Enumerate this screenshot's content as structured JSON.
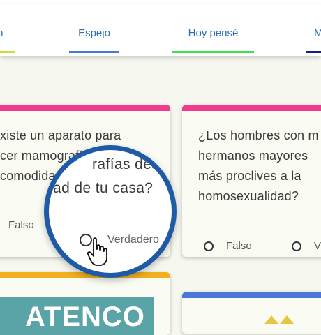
{
  "nav": {
    "items": [
      {
        "label": "o",
        "color": "#c6e234"
      },
      {
        "label": "Espejo",
        "color": "#4a78d8"
      },
      {
        "label": "Hoy pensé",
        "color": "#3fe04a"
      },
      {
        "label": "M",
        "color": "#1a1a8c"
      }
    ]
  },
  "cards": [
    {
      "accent": "#ef3b8e",
      "question_lines": [
        "xiste un aparato para",
        "cer mamografías desd",
        "comodidad de tu casa?"
      ],
      "options": [
        "Falso",
        "Verdadero"
      ]
    },
    {
      "accent": "#ef3b8e",
      "question_lines": [
        "¿Los hombres con m",
        "hermanos mayores",
        "más proclives a la",
        "homosexualidad?"
      ],
      "options": [
        "Falso",
        "V"
      ]
    },
    {
      "accent": "#f2b01e",
      "banner": "ATENCO"
    },
    {
      "accent": "#4a78d8"
    }
  ],
  "magnifier": {
    "question_lines": [
      "rafías desd",
      "ad de tu casa?"
    ],
    "option": "Verdadero"
  }
}
